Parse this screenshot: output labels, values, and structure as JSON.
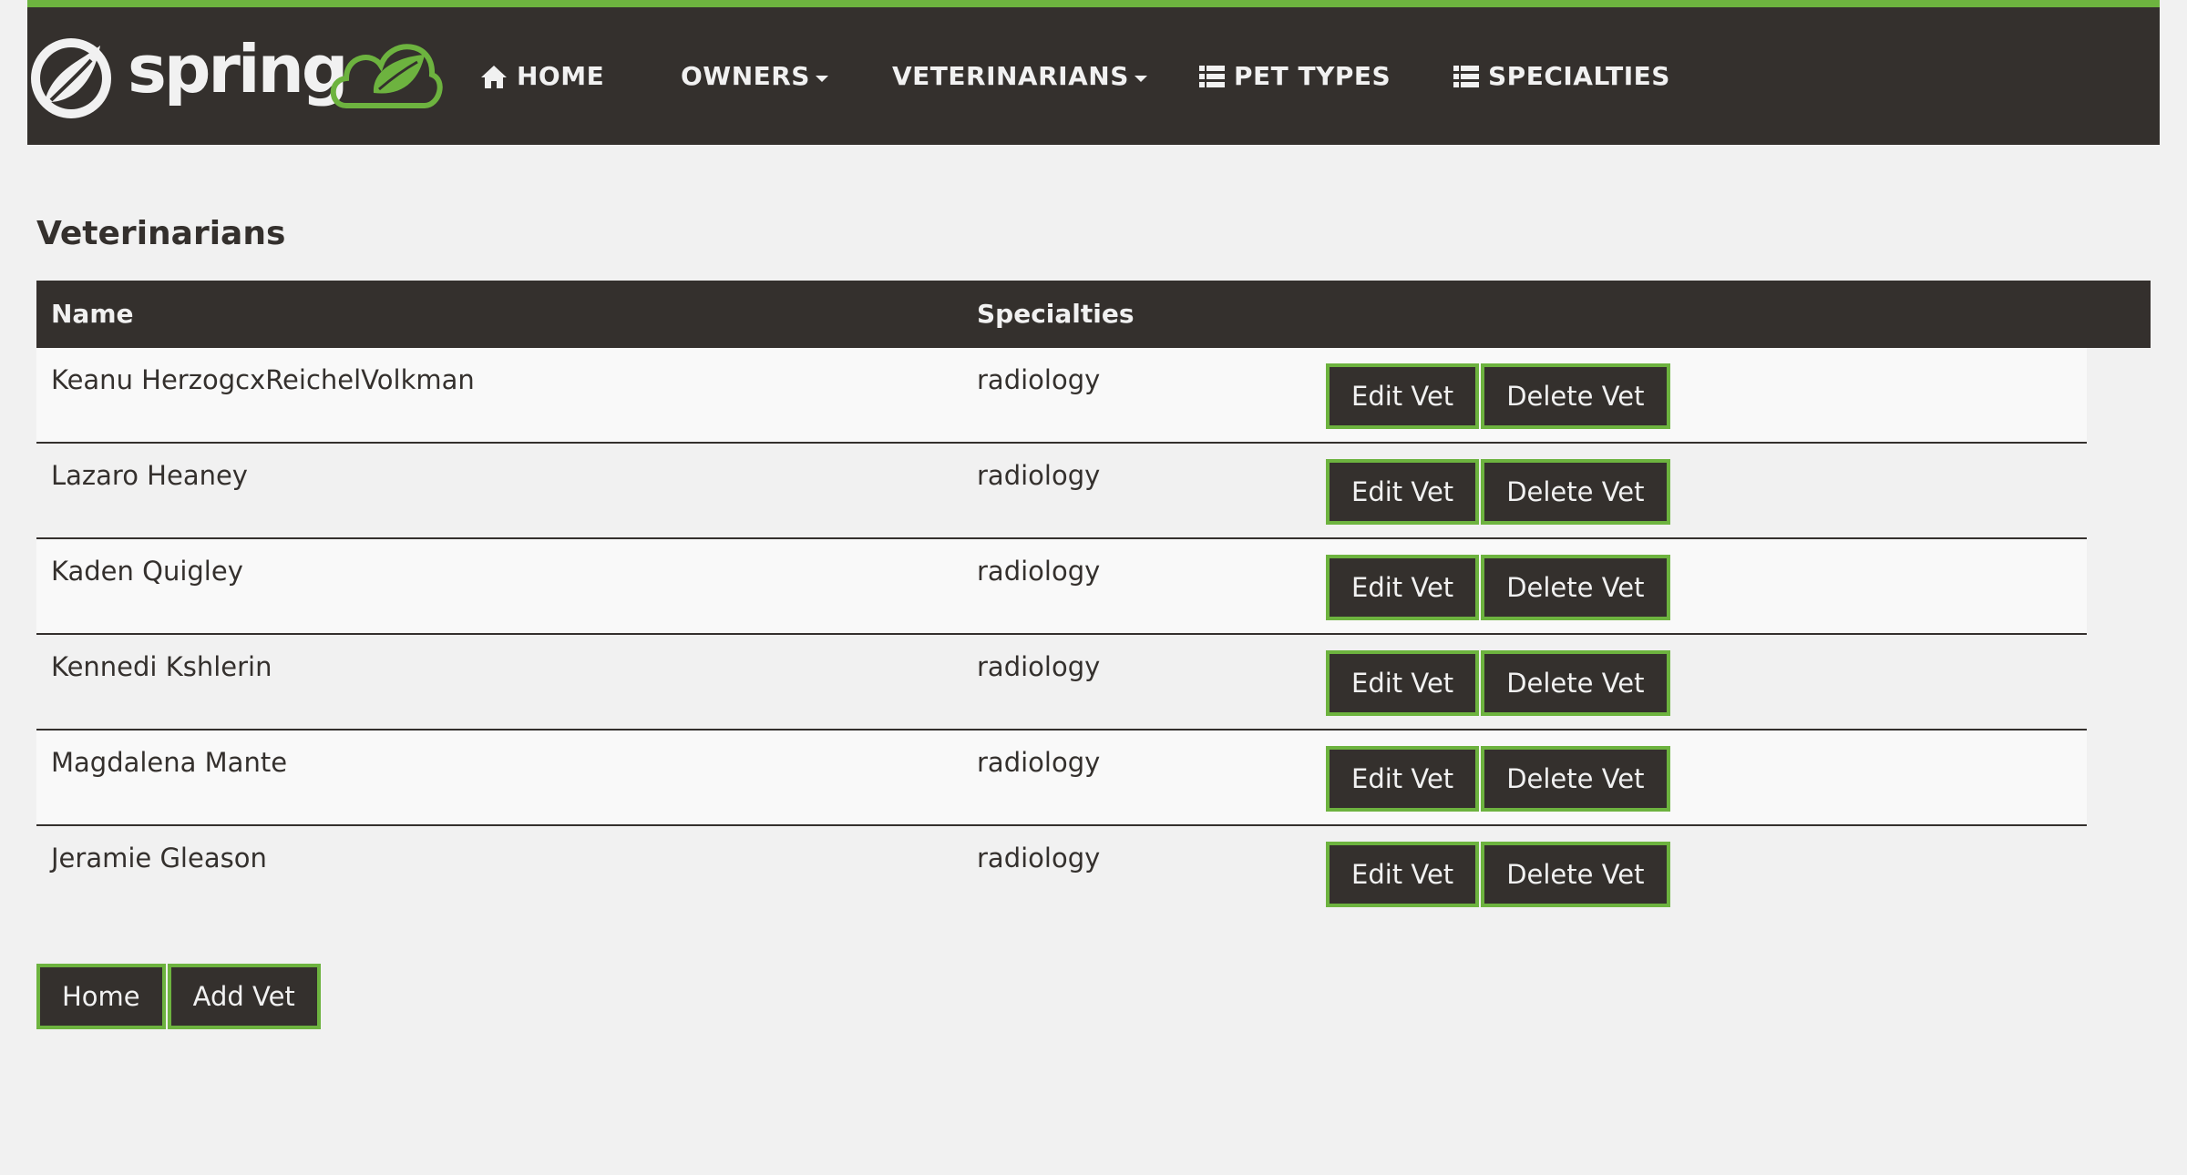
{
  "nav": {
    "brand": "spring",
    "items": [
      {
        "label": "HOME",
        "icon": "home-icon",
        "dropdown": false
      },
      {
        "label": "OWNERS",
        "icon": "",
        "dropdown": true
      },
      {
        "label": "VETERINARIANS",
        "icon": "",
        "dropdown": true
      },
      {
        "label": "PET TYPES",
        "icon": "list-icon",
        "dropdown": false
      },
      {
        "label": "SPECIALTIES",
        "icon": "list-icon",
        "dropdown": false
      }
    ]
  },
  "page": {
    "title": "Veterinarians"
  },
  "table": {
    "headers": {
      "name": "Name",
      "specialties": "Specialties"
    },
    "rows": [
      {
        "name": "Keanu HerzogcxReichelVolkman",
        "specialty": "radiology",
        "edit": "Edit Vet",
        "delete": "Delete Vet"
      },
      {
        "name": "Lazaro Heaney",
        "specialty": "radiology",
        "edit": "Edit Vet",
        "delete": "Delete Vet"
      },
      {
        "name": "Kaden Quigley",
        "specialty": "radiology",
        "edit": "Edit Vet",
        "delete": "Delete Vet"
      },
      {
        "name": "Kennedi Kshlerin",
        "specialty": "radiology",
        "edit": "Edit Vet",
        "delete": "Delete Vet"
      },
      {
        "name": "Magdalena Mante",
        "specialty": "radiology",
        "edit": "Edit Vet",
        "delete": "Delete Vet"
      },
      {
        "name": "Jeramie Gleason",
        "specialty": "radiology",
        "edit": "Edit Vet",
        "delete": "Delete Vet"
      }
    ]
  },
  "actions": {
    "home": "Home",
    "add_vet": "Add Vet"
  },
  "colors": {
    "brand_green": "#6db33f",
    "dark": "#34302d",
    "background": "#f1f1f1"
  }
}
